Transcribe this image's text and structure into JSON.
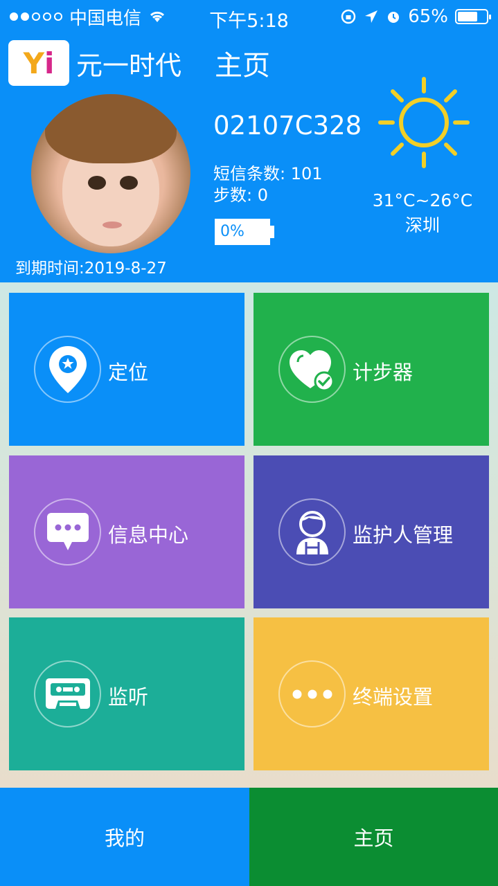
{
  "status_bar": {
    "carrier": "中国电信",
    "time": "下午5:18",
    "battery_percent": "65%",
    "signal_filled": 2,
    "signal_total": 5,
    "icons": [
      "wifi-icon",
      "rotation-lock-icon",
      "location-arrow-icon",
      "alarm-icon",
      "battery-icon"
    ]
  },
  "header": {
    "logo_text_y": "Y",
    "logo_text_i": "i",
    "app_name": "元一时代",
    "page_title": "主页"
  },
  "profile": {
    "expire_text": "到期时间:2019-8-27"
  },
  "device": {
    "id": "02107C328",
    "sms_count_text": "短信条数: 101",
    "steps_text": "步数: 0",
    "battery_text": "0%",
    "battery_level": 0
  },
  "weather": {
    "icon": "sun-icon",
    "temp_range": "31°C~26°C",
    "city": "深圳"
  },
  "tiles": [
    {
      "label": "定位",
      "icon": "location-pin-icon",
      "color": "#0a8ff8"
    },
    {
      "label": "计步器",
      "icon": "heart-check-icon",
      "color": "#21b14c"
    },
    {
      "label": "信息中心",
      "icon": "message-bubble-icon",
      "color": "#9966d6"
    },
    {
      "label": "监护人管理",
      "icon": "guardian-person-icon",
      "color": "#4b4db4"
    },
    {
      "label": "监听",
      "icon": "cassette-icon",
      "color": "#1cae98"
    },
    {
      "label": "终端设置",
      "icon": "more-dots-icon",
      "color": "#f6c043"
    }
  ],
  "tabs": [
    {
      "label": "我的",
      "color": "#0a8ff8"
    },
    {
      "label": "主页",
      "color": "#0b8d32"
    }
  ]
}
